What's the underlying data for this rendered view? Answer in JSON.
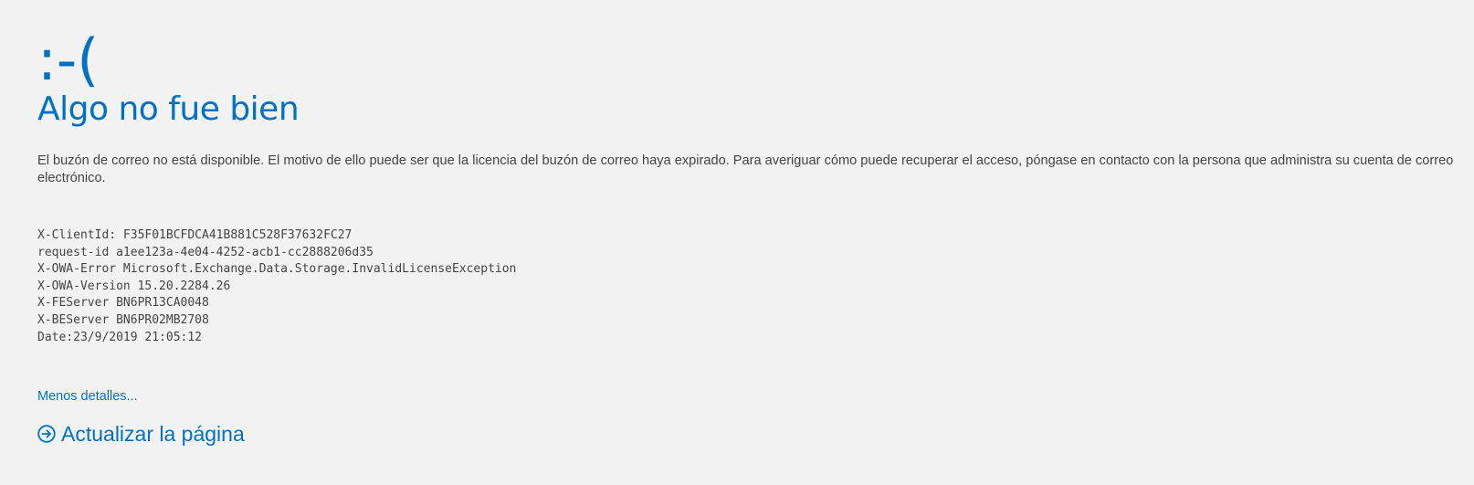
{
  "error": {
    "emoticon": ":-(",
    "title": "Algo no fue bien",
    "message": "El buzón de correo no está disponible. El motivo de ello puede ser que la licencia del buzón de correo haya expirado. Para averiguar cómo puede recuperar el acceso, póngase en contacto con la persona que administra su cuenta de correo electrónico."
  },
  "details": {
    "lines": [
      "X-ClientId: F35F01BCFDCA41B881C528F37632FC27",
      "request-id a1ee123a-4e04-4252-acb1-cc2888206d35",
      "X-OWA-Error Microsoft.Exchange.Data.Storage.InvalidLicenseException",
      "X-OWA-Version 15.20.2284.26",
      "X-FEServer BN6PR13CA0048",
      "X-BEServer BN6PR02MB2708",
      "Date:23/9/2019 21:05:12"
    ]
  },
  "links": {
    "less_details": "Menos detalles...",
    "refresh": "Actualizar la página",
    "refresh_icon": "circle-arrow-right-icon"
  },
  "colors": {
    "accent": "#0072c6",
    "text": "#444444",
    "background": "#f2f2f2"
  }
}
